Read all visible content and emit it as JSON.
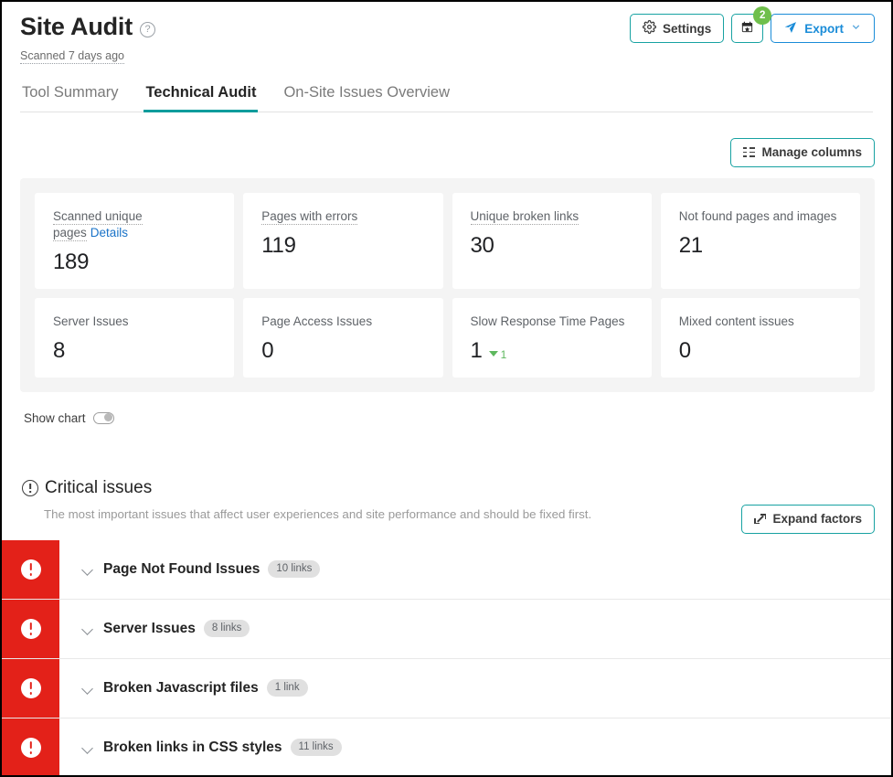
{
  "header": {
    "title": "Site Audit",
    "help_icon": "question-circle-icon",
    "scanned_text": "Scanned 7 days ago",
    "actions": {
      "settings_label": "Settings",
      "settings_icon": "gear-icon",
      "calendar_icon": "calendar-icon",
      "calendar_badge": "2",
      "export_label": "Export",
      "export_icon": "paper-plane-icon",
      "export_chevron": "chevron-down-icon"
    },
    "colors": {
      "teal": "#0d9c9c",
      "blue": "#1a8cd8",
      "green_badge": "#6fbf4b",
      "critical_red": "#e32119"
    }
  },
  "tabs": [
    {
      "label": "Tool Summary",
      "active": false
    },
    {
      "label": "Technical Audit",
      "active": true
    },
    {
      "label": "On-Site Issues Overview",
      "active": false
    }
  ],
  "toolbar": {
    "manage_columns_label": "Manage columns",
    "manage_columns_icon": "columns-list-icon"
  },
  "stats": [
    {
      "label": "Scanned unique pages",
      "dotted": true,
      "details_link": "Details",
      "value": "189"
    },
    {
      "label": "Pages with errors",
      "dotted": true,
      "value": "119"
    },
    {
      "label": "Unique broken links",
      "dotted": true,
      "value": "30"
    },
    {
      "label": "Not found pages and images",
      "dotted": false,
      "value": "21"
    },
    {
      "label": "Server Issues",
      "dotted": false,
      "value": "8"
    },
    {
      "label": "Page Access Issues",
      "dotted": false,
      "value": "0"
    },
    {
      "label": "Slow Response Time Pages",
      "dotted": false,
      "value": "1",
      "delta": "1",
      "delta_direction": "down"
    },
    {
      "label": "Mixed content issues",
      "dotted": false,
      "value": "0"
    }
  ],
  "show_chart": {
    "label": "Show chart",
    "state": "off"
  },
  "critical": {
    "icon": "alert-circle-icon",
    "title": "Critical issues",
    "subtitle": "The most important issues that affect user experiences and site performance and should be fixed first.",
    "expand_label": "Expand factors",
    "expand_icon": "expand-arrows-icon"
  },
  "issues": [
    {
      "severity_icon": "exclamation-circle-icon",
      "chevron": "chevron-down-icon",
      "name": "Page Not Found Issues",
      "links": "10 links"
    },
    {
      "severity_icon": "exclamation-circle-icon",
      "chevron": "chevron-down-icon",
      "name": "Server Issues",
      "links": "8 links"
    },
    {
      "severity_icon": "exclamation-circle-icon",
      "chevron": "chevron-down-icon",
      "name": "Broken Javascript files",
      "links": "1 link"
    },
    {
      "severity_icon": "exclamation-circle-icon",
      "chevron": "chevron-down-icon",
      "name": "Broken links in CSS styles",
      "links": "11 links"
    }
  ]
}
